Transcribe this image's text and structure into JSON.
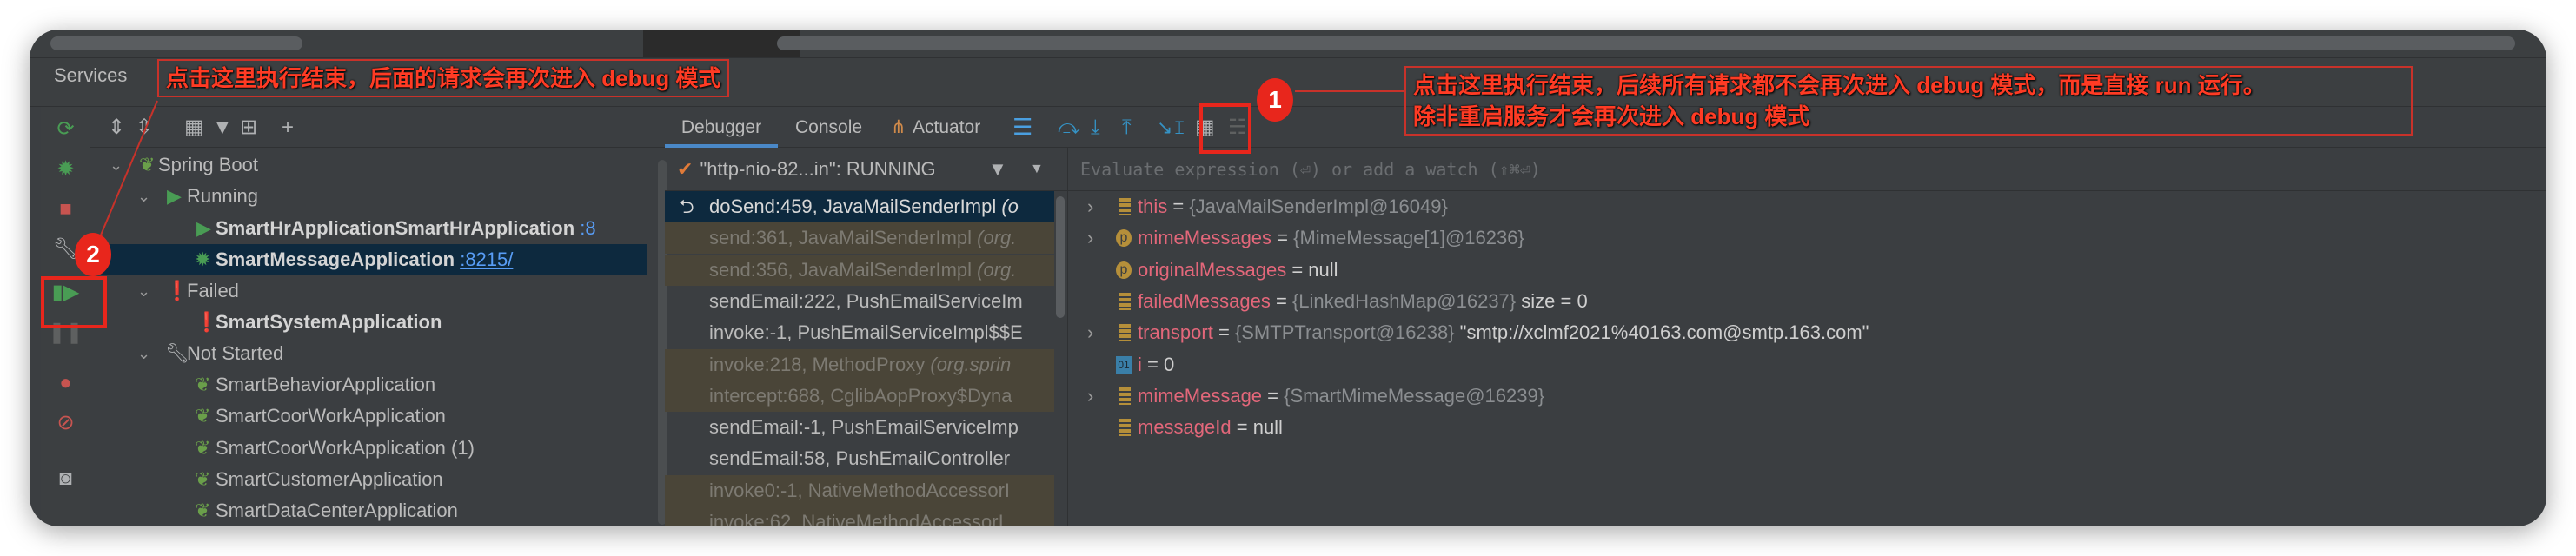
{
  "panel_title": "Services",
  "annotations": {
    "note_left": "点击这里执行结束，后面的请求会再次进入 debug 模式",
    "note_right_line1": "点击这里执行结束，后续所有请求都不会再次进入 debug 模式，而是直接 run 运行。",
    "note_right_line2": "除非重启服务才会再次进入 debug 模式",
    "badge_1": "1",
    "badge_2": "2",
    "highlight_color": "#e8261c"
  },
  "left_toolbar": [
    "rerun-icon",
    "debug-icon",
    "stop-icon",
    "wrench-icon",
    "resume-program-icon",
    "pause-icon",
    "breakpoints-icon",
    "mute-breakpoints-icon",
    "camera-icon"
  ],
  "tree_toolbar": [
    "expand-all-icon",
    "collapse-all-icon",
    "group-icon",
    "filter-icon",
    "new-tab-icon",
    "add-icon"
  ],
  "tree": {
    "spring_boot": "Spring Boot",
    "running": "Running",
    "hr_app": "SmartHrApplicationSmartHrApplication",
    "hr_port": ":8",
    "msg_app": "SmartMessageApplication",
    "msg_port": ":8215/",
    "failed": "Failed",
    "system_app": "SmartSystemApplication",
    "not_started": "Not Started",
    "not_started_apps": [
      "SmartBehaviorApplication",
      "SmartCoorWorkApplication",
      "SmartCoorWorkApplication (1)",
      "SmartCustomerApplication",
      "SmartDataCenterApplication"
    ]
  },
  "debugger": {
    "tabs": [
      "Debugger",
      "Console",
      "Actuator"
    ],
    "active_tab": "Debugger",
    "thread": "\"http-nio-82...in\": RUNNING",
    "eval_placeholder": "Evaluate expression (⏎) or add a watch (⇧⌘⏎)",
    "frames": [
      {
        "text": "doSend:459, JavaMailSenderImpl ",
        "pkg": "(o",
        "kind": "selected"
      },
      {
        "text": "send:361, JavaMailSenderImpl ",
        "pkg": "(org.",
        "kind": "lib"
      },
      {
        "text": "send:356, JavaMailSenderImpl ",
        "pkg": "(org.",
        "kind": "lib"
      },
      {
        "text": "sendEmail:222, PushEmailServiceIm",
        "pkg": "",
        "kind": "app"
      },
      {
        "text": "invoke:-1, PushEmailServiceImpl$$E",
        "pkg": "",
        "kind": "app"
      },
      {
        "text": "invoke:218, MethodProxy ",
        "pkg": "(org.sprin",
        "kind": "lib"
      },
      {
        "text": "intercept:688, CglibAopProxy$Dyna",
        "pkg": "",
        "kind": "lib"
      },
      {
        "text": "sendEmail:-1, PushEmailServiceImp",
        "pkg": "",
        "kind": "app"
      },
      {
        "text": "sendEmail:58, PushEmailController",
        "pkg": "",
        "kind": "app"
      },
      {
        "text": "invoke0:-1, NativeMethodAccessorI",
        "pkg": "",
        "kind": "lib"
      },
      {
        "text": "invoke:62, NativeMethodAccessorI",
        "pkg": "",
        "kind": "lib"
      }
    ],
    "variables": [
      {
        "name": "this",
        "value": "{JavaMailSenderImpl@16049}",
        "extra": "",
        "icon": "field",
        "expandable": true
      },
      {
        "name": "mimeMessages",
        "value": "{MimeMessage[1]@16236}",
        "extra": "",
        "icon": "param",
        "expandable": true
      },
      {
        "name": "originalMessages",
        "value": "",
        "extra": "null",
        "icon": "param",
        "expandable": false
      },
      {
        "name": "failedMessages",
        "value": "{LinkedHashMap@16237}",
        "extra": " size = 0",
        "icon": "field",
        "expandable": false
      },
      {
        "name": "transport",
        "value": "{SMTPTransport@16238}",
        "extra": " \"smtp://xclmf2021%40163.com@smtp.163.com\"",
        "icon": "field",
        "expandable": true
      },
      {
        "name": "i",
        "value": "",
        "extra": "0",
        "icon": "primitive",
        "expandable": false
      },
      {
        "name": "mimeMessage",
        "value": "{SmartMimeMessage@16239}",
        "extra": "",
        "icon": "field",
        "expandable": true
      },
      {
        "name": "messageId",
        "value": "",
        "extra": "null",
        "icon": "field",
        "expandable": false
      }
    ]
  }
}
